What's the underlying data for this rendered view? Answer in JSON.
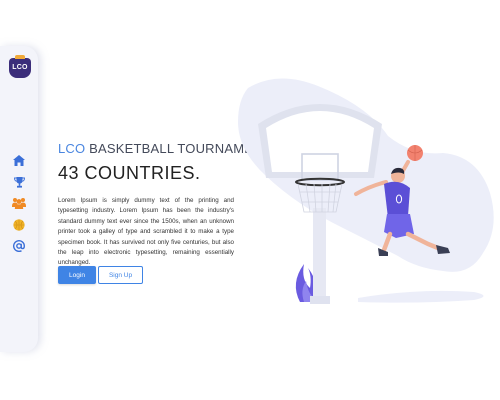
{
  "brand": {
    "logo_text": "LCO",
    "logo_icon": "team-crest-logo"
  },
  "sidebar": {
    "items": [
      {
        "icon": "home-icon",
        "color": "#3b6fd8"
      },
      {
        "icon": "trophy-icon",
        "color": "#3b6fd8"
      },
      {
        "icon": "team-icon",
        "color": "#f08a24"
      },
      {
        "icon": "basketball-icon",
        "color": "#f0b429"
      },
      {
        "icon": "at-sign-icon",
        "color": "#3b6fd8"
      }
    ]
  },
  "hero": {
    "subtitle_accent": "LCO",
    "subtitle_rest": " BASKETBALL TOURNAMENT",
    "title": "43 COUNTRIES.",
    "body": "Lorem Ipsum is simply dummy text of the printing and typesetting industry. Lorem Ipsum has been the industry's standard dummy text ever since the 1500s, when an unknown printer took a galley of type and scrambled it to make a type specimen book. It has survived not only five centuries, but also the leap into electronic typesetting, remaining essentially unchanged."
  },
  "buttons": {
    "login": "Login",
    "signup": "Sign Up"
  },
  "colors": {
    "accent": "#3f84e5",
    "sidebar_bg": "#f3f4fa",
    "blob": "#eceef9",
    "jersey": "#5b4fd6",
    "ball": "#f2826f"
  }
}
